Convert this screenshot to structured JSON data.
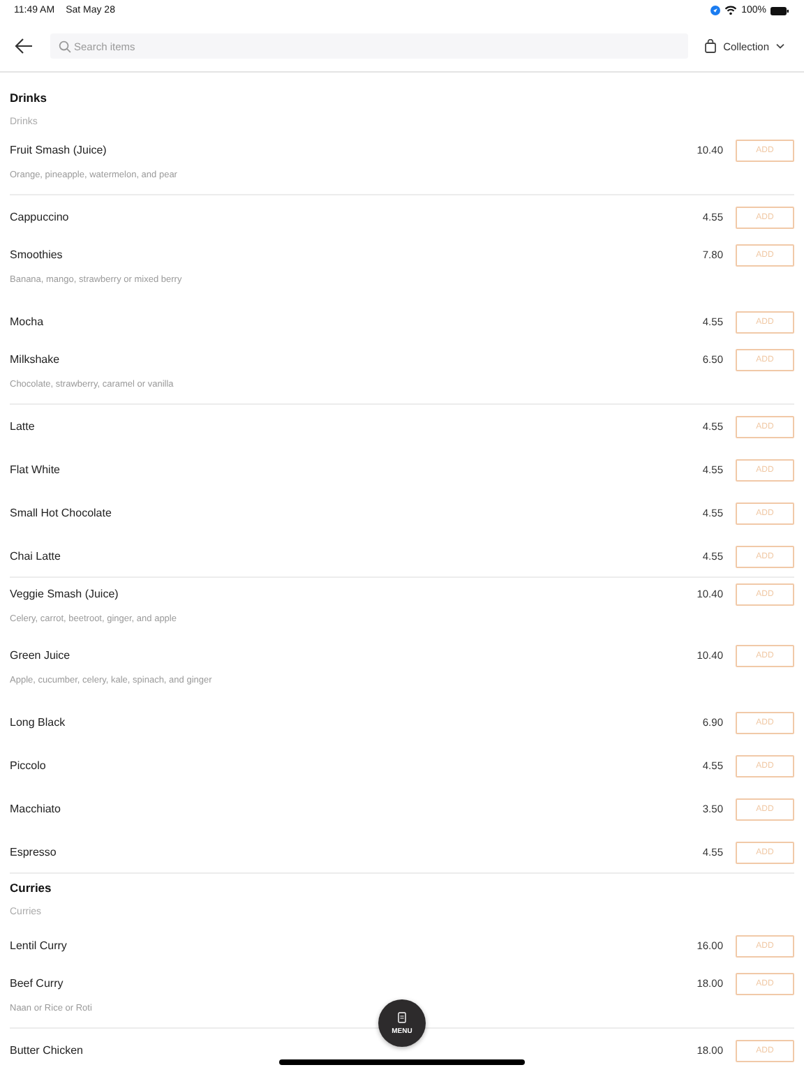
{
  "status_bar": {
    "time": "11:49 AM",
    "date": "Sat May 28",
    "battery": "100%"
  },
  "header": {
    "search": {
      "placeholder": "Search items"
    },
    "order_type": "Collection"
  },
  "sections": [
    {
      "title": "Drinks",
      "subtitle": "Drinks",
      "items": [
        {
          "name": "Fruit Smash (Juice)",
          "description": "Orange, pineapple, watermelon, and pear",
          "price": "10.40",
          "button": "ADD",
          "divider": true
        },
        {
          "name": "Cappuccino",
          "price": "4.55",
          "button": "ADD",
          "divider": false
        },
        {
          "name": "Smoothies",
          "description": "Banana, mango, strawberry or mixed berry",
          "price": "7.80",
          "button": "ADD",
          "divider": false
        },
        {
          "name": "Mocha",
          "price": "4.55",
          "button": "ADD",
          "divider": false
        },
        {
          "name": "Milkshake",
          "description": "Chocolate, strawberry, caramel or vanilla",
          "price": "6.50",
          "button": "ADD",
          "divider": true
        },
        {
          "name": "Latte",
          "price": "4.55",
          "button": "ADD",
          "divider": false
        },
        {
          "name": "Flat White",
          "price": "4.55",
          "button": "ADD",
          "divider": false
        },
        {
          "name": "Small Hot Chocolate",
          "price": "4.55",
          "button": "ADD",
          "divider": false
        },
        {
          "name": "Chai Latte",
          "price": "4.55",
          "button": "ADD",
          "divider": true
        },
        {
          "name": "Veggie Smash (Juice)",
          "description": "Celery, carrot, beetroot, ginger, and apple",
          "price": "10.40",
          "button": "ADD",
          "divider": false
        },
        {
          "name": "Green Juice",
          "description": "Apple, cucumber, celery, kale, spinach, and ginger",
          "price": "10.40",
          "button": "ADD",
          "divider": false
        },
        {
          "name": "Long Black",
          "price": "6.90",
          "button": "ADD",
          "divider": false
        },
        {
          "name": "Piccolo",
          "price": "4.55",
          "button": "ADD",
          "divider": false
        },
        {
          "name": "Macchiato",
          "price": "3.50",
          "button": "ADD",
          "divider": false
        },
        {
          "name": "Espresso",
          "price": "4.55",
          "button": "ADD",
          "divider": true
        }
      ]
    },
    {
      "title": "Curries",
      "subtitle": "Curries",
      "items": [
        {
          "name": "Lentil Curry",
          "price": "16.00",
          "button": "ADD",
          "divider": false
        },
        {
          "name": "Beef Curry",
          "description": "Naan or Rice or Roti",
          "price": "18.00",
          "button": "ADD",
          "divider": true
        },
        {
          "name": "Butter Chicken",
          "price": "18.00",
          "button": "ADD",
          "divider": false
        }
      ]
    }
  ],
  "menu_button": "MENU"
}
